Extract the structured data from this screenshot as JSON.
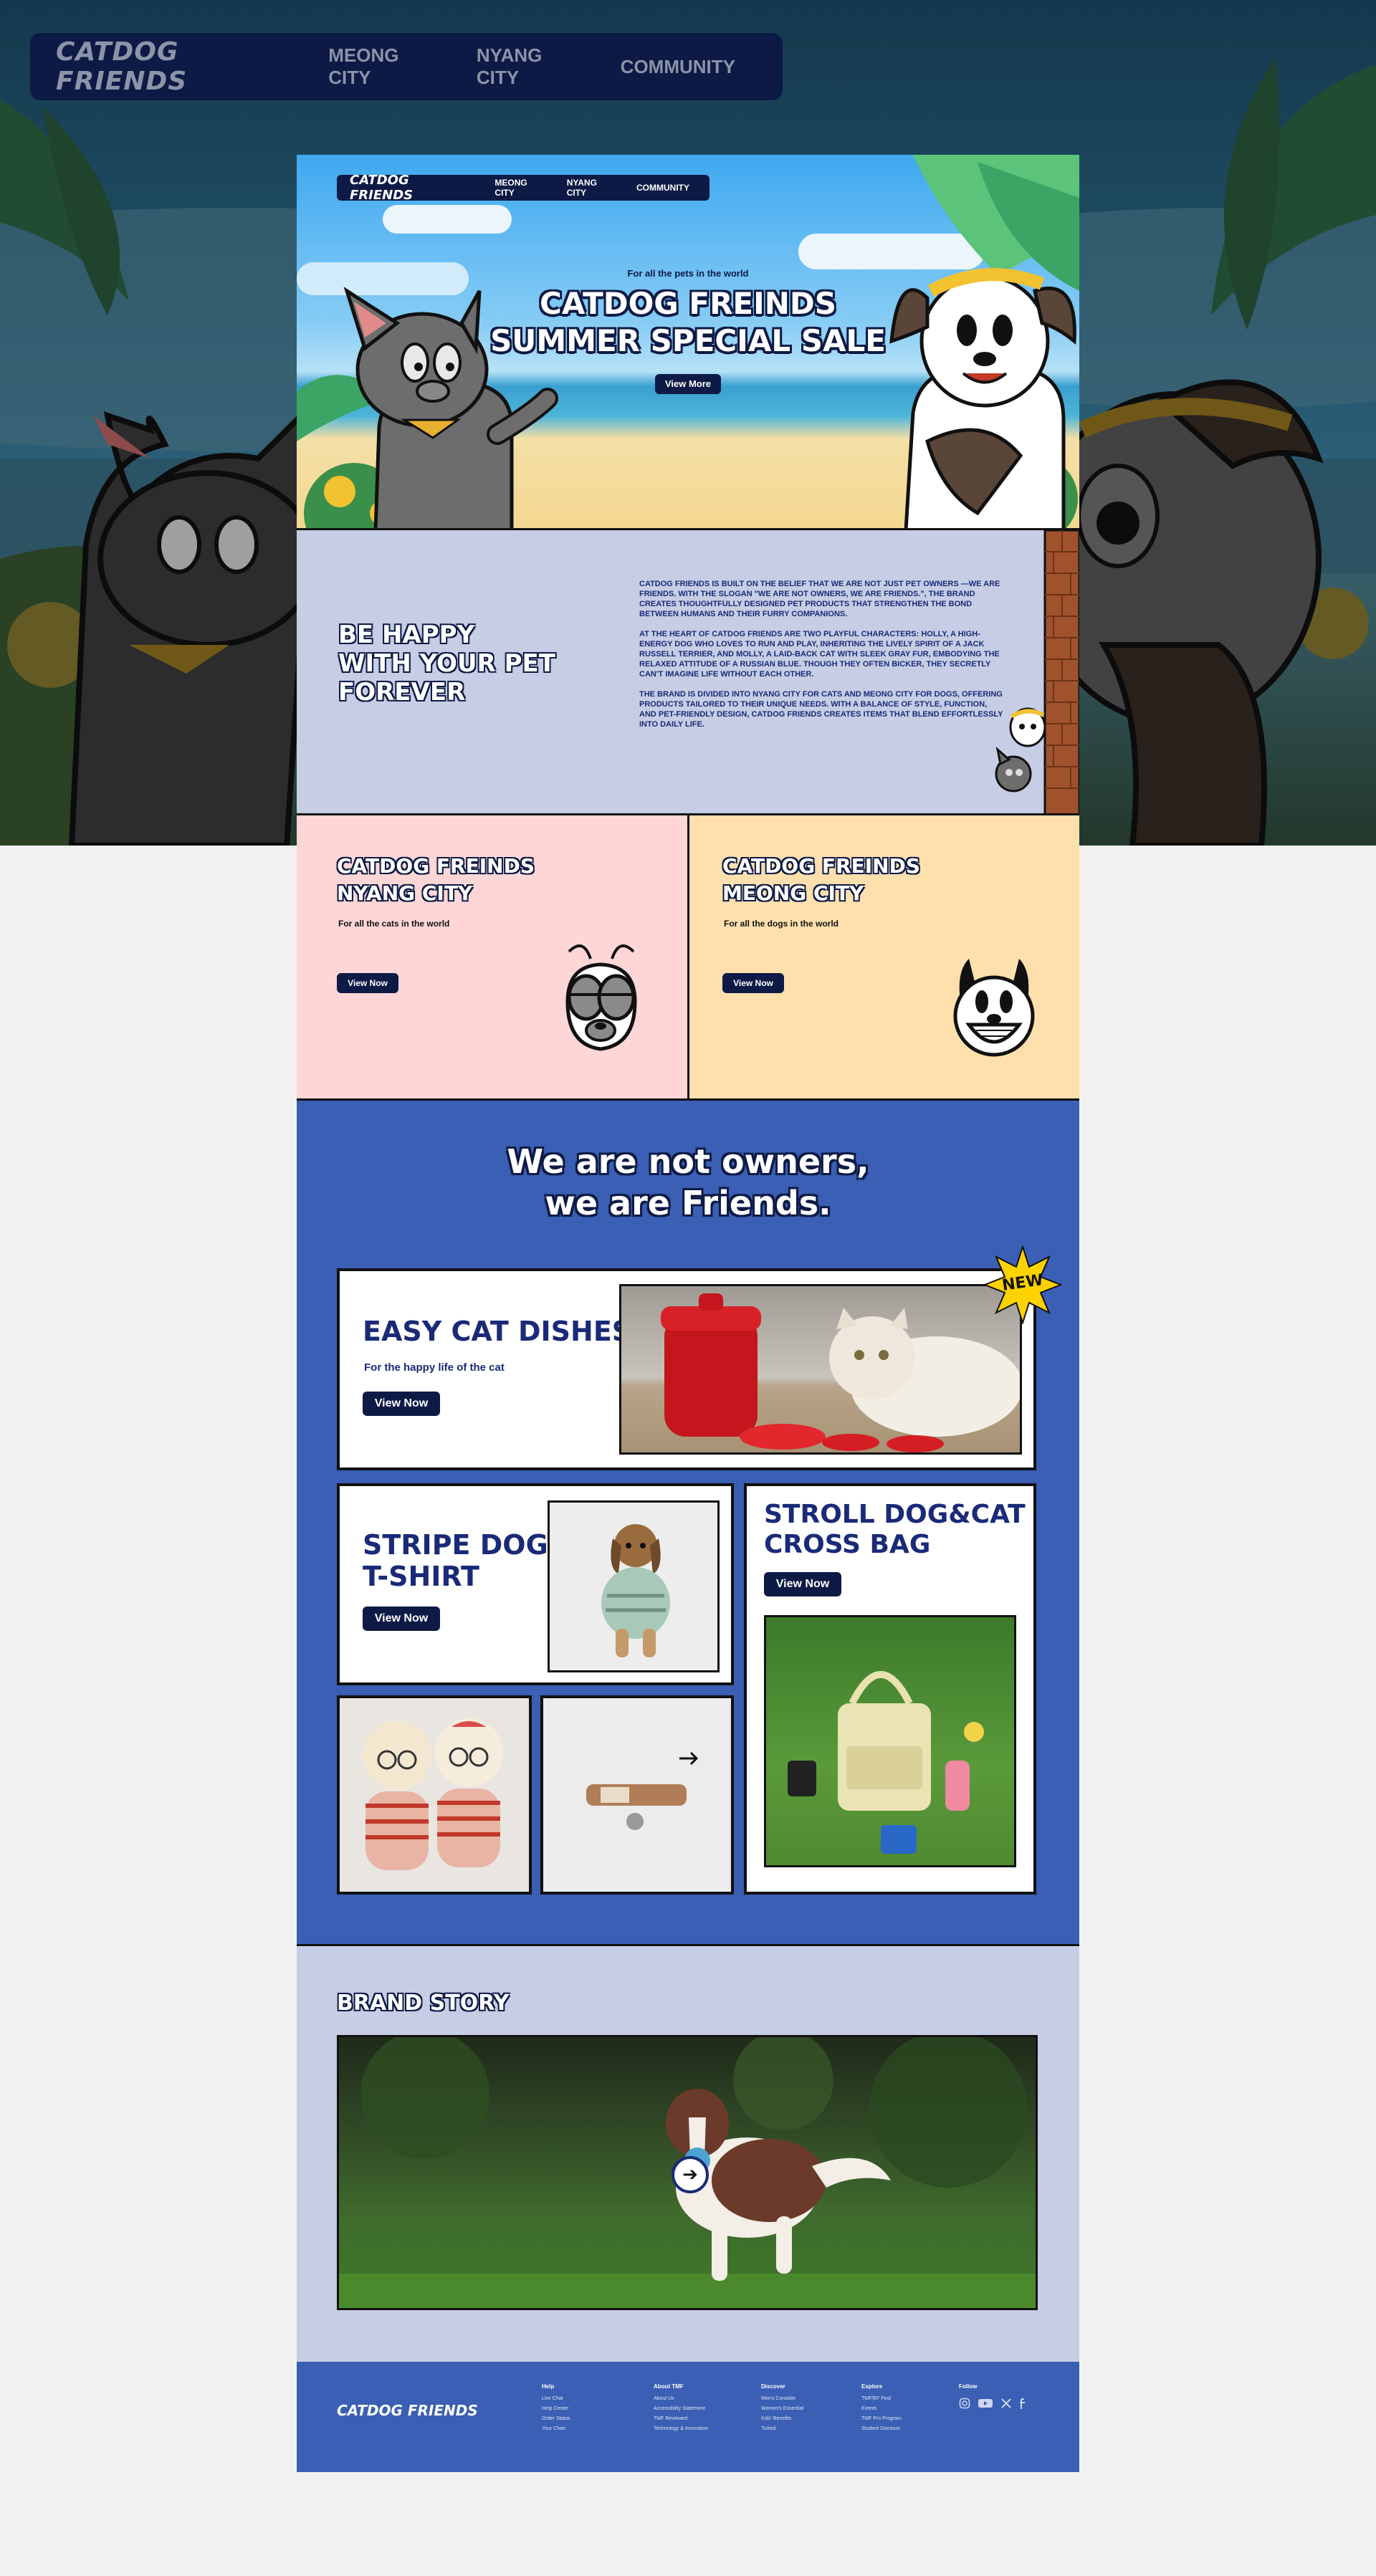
{
  "top_nav": {
    "logo": "CATDOG FRIENDS",
    "links": [
      "MEONG CITY",
      "NYANG CITY",
      "COMMUNITY"
    ]
  },
  "hero": {
    "nav": {
      "logo": "CATDOG FRIENDS",
      "links": [
        "MEONG CITY",
        "NYANG CITY",
        "COMMUNITY"
      ]
    },
    "tagline": "For all the pets in the world",
    "title_line1": "CATDOG FREINDS",
    "title_line2": "SUMMER SPECIAL SALE",
    "button": "View More"
  },
  "about": {
    "heading_line1": "BE HAPPY",
    "heading_line2": "WITH YOUR PET",
    "heading_line3": "FOREVER",
    "paragraphs": [
      "CATDOG FRIENDS IS BUILT ON THE BELIEF THAT WE ARE NOT JUST PET OWNERS —WE ARE FRIENDS. WITH THE SLOGAN \"WE ARE NOT OWNERS, WE ARE FRIENDS.\", THE BRAND CREATES THOUGHTFULLY DESIGNED PET PRODUCTS THAT STRENGTHEN THE BOND BETWEEN HUMANS AND THEIR FURRY COMPANIONS.",
      "AT THE HEART OF CATDOG FRIENDS ARE TWO PLAYFUL CHARACTERS: HOLLY, A HIGH-ENERGY DOG WHO LOVES TO RUN AND PLAY, INHERITING THE LIVELY SPIRIT OF A JACK RUSSELL TERRIER, AND MOLLY, A LAID-BACK CAT WITH SLEEK GRAY FUR, EMBODYING THE RELAXED ATTITUDE OF A RUSSIAN BLUE. THOUGH THEY OFTEN BICKER, THEY SECRETLY CAN'T IMAGINE LIFE WITHOUT EACH OTHER.",
      "THE BRAND IS DIVIDED INTO NYANG CITY FOR CATS AND MEONG CITY FOR DOGS, OFFERING PRODUCTS TAILORED TO THEIR UNIQUE NEEDS. WITH A BALANCE OF STYLE, FUNCTION, AND PET-FRIENDLY DESIGN, CATDOG FRIENDS CREATES ITEMS THAT BLEND EFFORTLESSLY INTO DAILY LIFE."
    ]
  },
  "nyang_city": {
    "title_line1": "CATDOG FREINDS",
    "title_line2": "NYANG CITY",
    "subtitle": "For all the cats in the world",
    "button": "View Now"
  },
  "meong_city": {
    "title_line1": "CATDOG FREINDS",
    "title_line2": "MEONG CITY",
    "subtitle": "For all the dogs in the world",
    "button": "View Now"
  },
  "products": {
    "heading_line1": "We are not owners,",
    "heading_line2": "we are Friends.",
    "new_badge": "NEW",
    "cat_dishes": {
      "title": "EASY CAT DISHES",
      "subtitle": "For the happy life of the cat",
      "button": "View Now"
    },
    "tshirt": {
      "title_line1": "STRIPE DOG",
      "title_line2": "T-SHIRT",
      "button": "View Now"
    },
    "bag": {
      "title_line1": "STROLL DOG&CAT",
      "title_line2": "CROSS BAG",
      "button": "View Now"
    }
  },
  "brand_story": {
    "heading": "BRAND STORY"
  },
  "footer": {
    "logo": "CATDOG FRIENDS",
    "columns": [
      {
        "heading": "Help",
        "items": [
          "Live Chat",
          "Help Center",
          "Order Status",
          "Your Chart"
        ]
      },
      {
        "heading": "About TMF",
        "items": [
          "About Us",
          "Accessibility Statement",
          "TMF Reviewed",
          "Technology & Innovation"
        ]
      },
      {
        "heading": "Discover",
        "items": [
          "Men's Consider",
          "Women's Essential",
          "Kids' Benefits",
          "Ticked"
        ]
      },
      {
        "heading": "Explore",
        "items": [
          "TMF/EF Find",
          "Events",
          "TMF Pro Program",
          "Student Discount"
        ]
      },
      {
        "heading": "Follow",
        "items": []
      }
    ],
    "social_icons": [
      "instagram-icon",
      "youtube-icon",
      "x-icon",
      "facebook-icon"
    ]
  },
  "colors": {
    "navy": "#0d1a45",
    "royal_blue": "#3a5fb4",
    "lavender": "#c6cde4",
    "pink": "#ffd6d6",
    "peach": "#ffe0ad",
    "title_blue": "#1a2a78",
    "new_yellow": "#ffd200"
  }
}
